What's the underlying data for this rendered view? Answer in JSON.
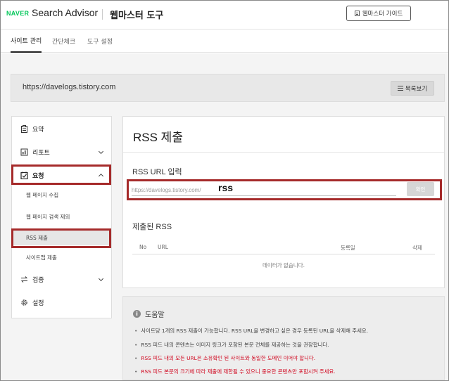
{
  "header": {
    "brand": "NAVER",
    "product": "Search Advisor",
    "tool_name": "웹마스터 도구",
    "guide_button": "웹마스터 가이드"
  },
  "tabs": [
    {
      "label": "사이트 관리",
      "active": true
    },
    {
      "label": "간단체크",
      "active": false
    },
    {
      "label": "도구 설정",
      "active": false
    }
  ],
  "site": {
    "url": "https://davelogs.tistory.com",
    "list_button": "목록보기"
  },
  "sidebar": {
    "items": [
      {
        "label": "요약",
        "icon": "clipboard-icon"
      },
      {
        "label": "리포트",
        "icon": "report-icon"
      },
      {
        "label": "요청",
        "icon": "request-check-icon"
      },
      {
        "label": "검증",
        "icon": "swap-icon"
      },
      {
        "label": "설정",
        "icon": "gear-icon"
      }
    ],
    "sub_items": [
      {
        "label": "웹 페이지 수집"
      },
      {
        "label": "웹 페이지 검색 제외"
      },
      {
        "label": "RSS 제출"
      },
      {
        "label": "사이트맵 제출"
      }
    ]
  },
  "main": {
    "title": "RSS 제출",
    "input_label": "RSS URL 입력",
    "input_prefix": "https://davelogs.tistory.com/",
    "input_typed": "rss",
    "confirm_button": "확인",
    "submitted_label": "제출된 RSS",
    "table_headers": [
      "No",
      "URL",
      "등록일",
      "삭제"
    ],
    "empty_message": "데이터가 없습니다."
  },
  "help": {
    "title": "도움말",
    "lines": [
      {
        "text": "사이트당 1개의 RSS 제출이 가능합니다. RSS URL을 변경하고 싶은 경우 등록된 URL을 삭제해 주세요.",
        "color": "#444444"
      },
      {
        "text": "RSS 피드 내의 콘텐츠는 이미지 링크가 포함된 본문 전체를 제공하는 것을 권장합니다.",
        "color": "#444444"
      },
      {
        "text": "RSS 피드 내의 모든 URL은 소유확인 된 사이트와 동일한 도메인 이어야 합니다.",
        "color": "#d0021b"
      },
      {
        "text": "RSS 피드 본문의 크기에 따라 제출에 제한될 수 있으니 중요한 콘텐츠만 포함시켜 주세요.",
        "color": "#d0021b"
      }
    ]
  },
  "colors": {
    "brand_green": "#03c75a",
    "highlight_red": "#a52a2a"
  }
}
